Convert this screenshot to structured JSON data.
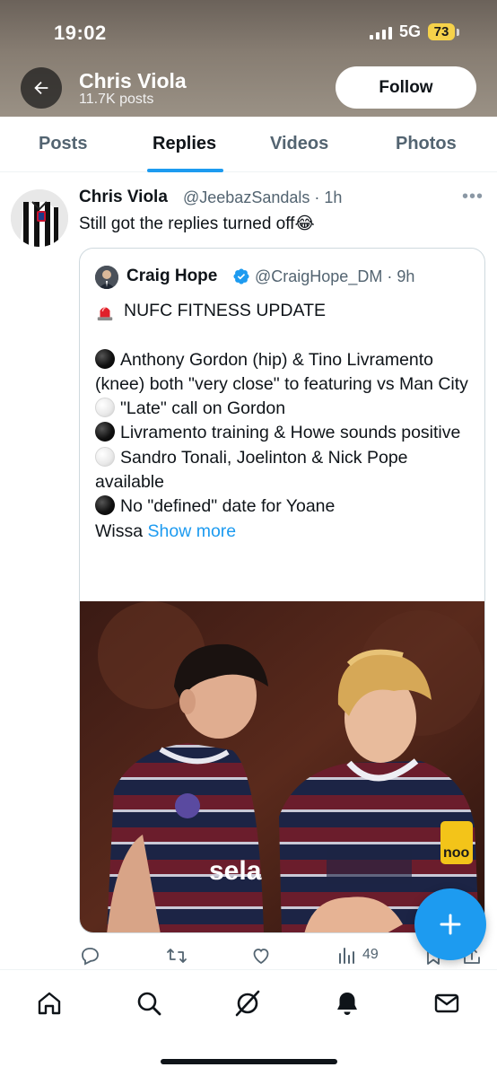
{
  "status_bar": {
    "time": "19:02",
    "network": "5G",
    "battery": "73",
    "battery_color": "#f6d24a"
  },
  "header": {
    "back_icon": "arrow-left-icon",
    "profile_name": "Chris Viola",
    "post_count": "11.7K posts",
    "follow_label": "Follow"
  },
  "tabs": [
    {
      "label": "Posts",
      "active": false
    },
    {
      "label": "Replies",
      "active": true
    },
    {
      "label": "Videos",
      "active": false
    },
    {
      "label": "Photos",
      "active": false
    }
  ],
  "tweet": {
    "author_name": "Chris Viola",
    "author_handle": "@JeebazSandals · 1h",
    "more_icon": "more-horizontal-icon",
    "text": "Still got the replies turned off😂",
    "quoted": {
      "author_name": "Craig Hope",
      "author_handle": "@CraigHope_DM · 9h",
      "verified": true,
      "lines": [
        {
          "marker": "siren",
          "text": "NUFC FITNESS UPDATE"
        },
        {
          "marker": "none",
          "text": ""
        },
        {
          "marker": "black",
          "text": "Anthony Gordon (hip) & Tino Livramento (knee) both \"very close\" to featuring vs Man City"
        },
        {
          "marker": "white",
          "text": "\"Late\" call on Gordon"
        },
        {
          "marker": "black",
          "text": "Livramento training & Howe sounds positive"
        },
        {
          "marker": "white",
          "text": "Sandro Tonali, Joelinton & Nick Pope available"
        },
        {
          "marker": "black",
          "text": "No \"defined\" date for Yoane"
        }
      ],
      "last_line": "Wissa",
      "show_more": "Show more",
      "image_sponsor_text": "sela",
      "image_badge_text": "noo"
    },
    "actions": {
      "reply_icon": "reply-icon",
      "retweet_icon": "retweet-icon",
      "like_icon": "heart-icon",
      "views_icon": "views-icon",
      "views_count": "49",
      "bookmark_icon": "bookmark-icon",
      "share_icon": "share-icon"
    }
  },
  "fab": {
    "icon": "plus-icon",
    "color": "#1d9bf0"
  },
  "bottom_nav": [
    {
      "icon": "home-icon"
    },
    {
      "icon": "search-icon"
    },
    {
      "icon": "grok-icon"
    },
    {
      "icon": "notifications-icon"
    },
    {
      "icon": "messages-icon"
    }
  ],
  "colors": {
    "accent": "#1d9bf0",
    "text": "#0f1419",
    "secondary_text": "#536471"
  }
}
